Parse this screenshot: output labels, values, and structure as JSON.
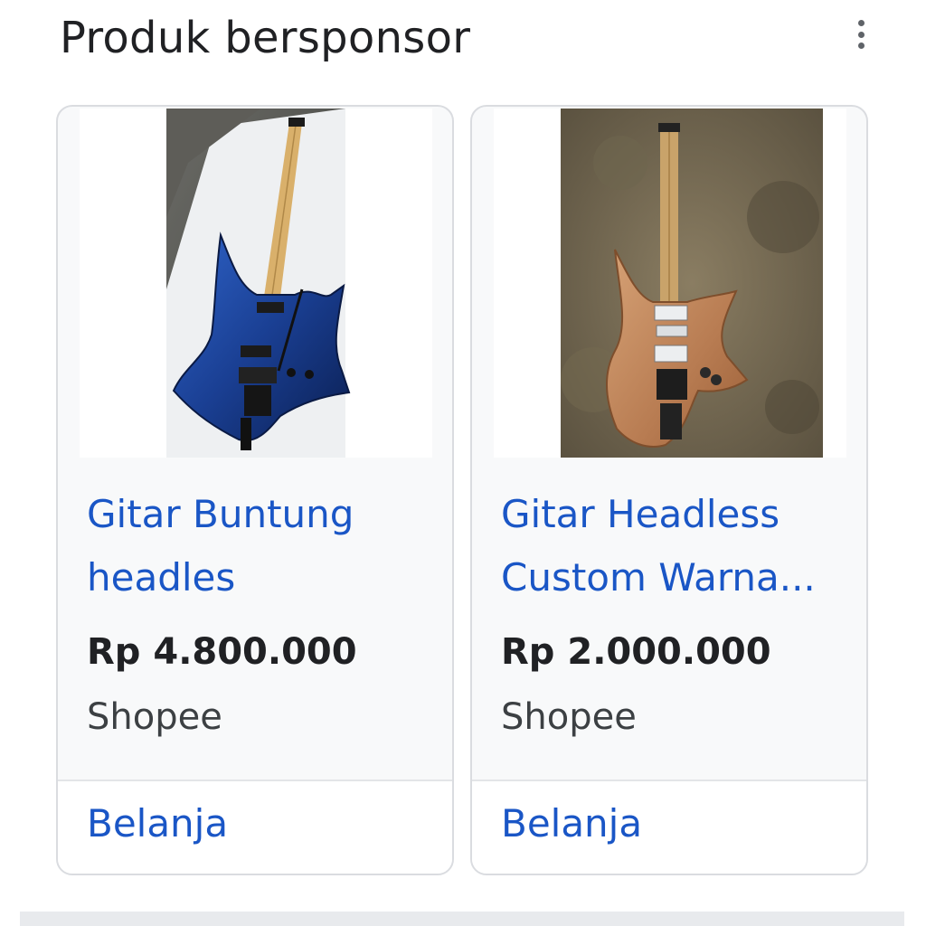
{
  "header": {
    "title": "Produk bersponsor"
  },
  "products": [
    {
      "title_line1": "Gitar Buntung",
      "title_line2": "headles",
      "price": "Rp 4.800.000",
      "merchant": "Shopee",
      "action": "Belanja",
      "image_icon": "headless-guitar-blue-icon"
    },
    {
      "title_line1": "Gitar Headless",
      "title_line2": "Custom Warna...",
      "price": "Rp 2.000.000",
      "merchant": "Shopee",
      "action": "Belanja",
      "image_icon": "headless-guitar-wood-icon"
    }
  ],
  "colors": {
    "link": "#1a56c6",
    "card_bg": "#f8f9fa",
    "card_border": "#dadce0",
    "text": "#202124"
  }
}
